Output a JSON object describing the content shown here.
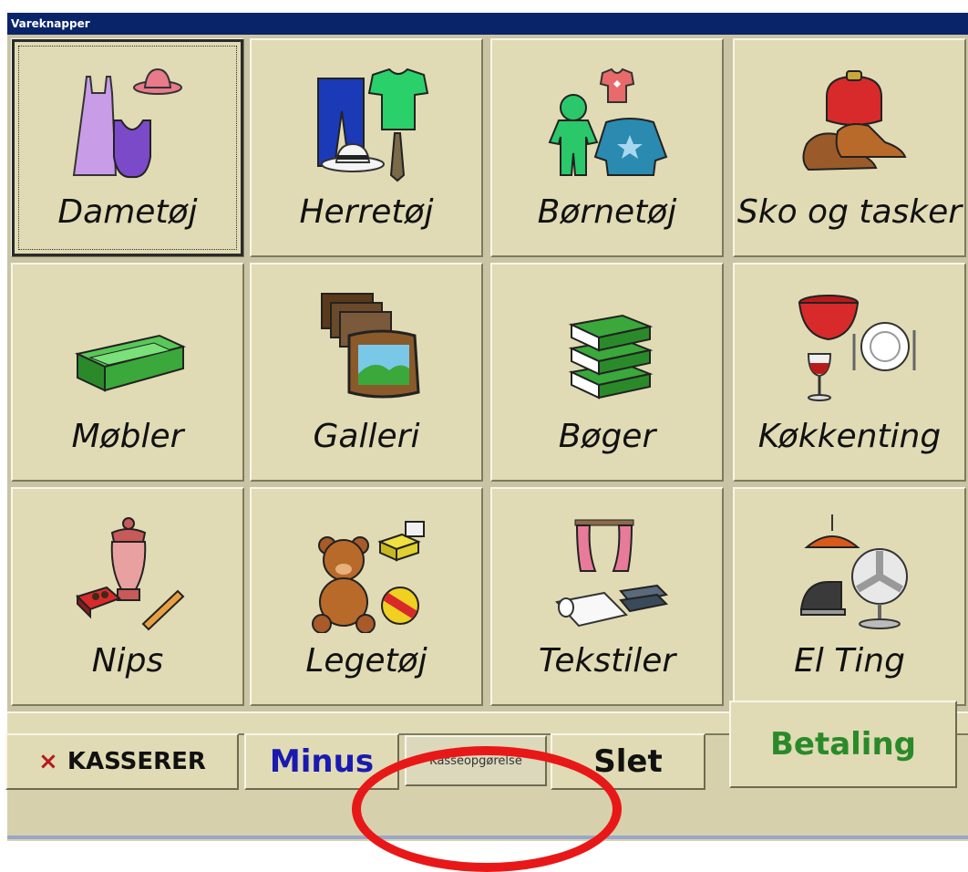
{
  "window": {
    "title": "Vareknapper"
  },
  "tiles": [
    {
      "label": "Dametøj",
      "icon": "women-clothing-icon"
    },
    {
      "label": "Herretøj",
      "icon": "men-clothing-icon"
    },
    {
      "label": "Børnetøj",
      "icon": "children-clothing-icon"
    },
    {
      "label": "Sko og tasker",
      "icon": "shoes-bags-icon"
    },
    {
      "label": "Møbler",
      "icon": "sofa-icon"
    },
    {
      "label": "Galleri",
      "icon": "picture-frames-icon"
    },
    {
      "label": "Bøger",
      "icon": "books-icon"
    },
    {
      "label": "Køkkenting",
      "icon": "kitchenware-icon"
    },
    {
      "label": "Nips",
      "icon": "knickknacks-icon"
    },
    {
      "label": "Legetøj",
      "icon": "toys-icon"
    },
    {
      "label": "Tekstiler",
      "icon": "textiles-icon"
    },
    {
      "label": "El Ting",
      "icon": "electrical-icon"
    }
  ],
  "buttons": {
    "kasserer_prefix": "×",
    "kasserer": "KASSERER",
    "minus": "Minus",
    "kasseopgorelse": "Kasseopgørelse",
    "slet": "Slet",
    "betaling": "Betaling"
  },
  "colors": {
    "title_bar": "#0a246a",
    "tile_face": "#e0dbb4",
    "minus_text": "#1a1ab0",
    "betaling_text": "#2a8a2a",
    "annotation_circle": "#e81818"
  }
}
